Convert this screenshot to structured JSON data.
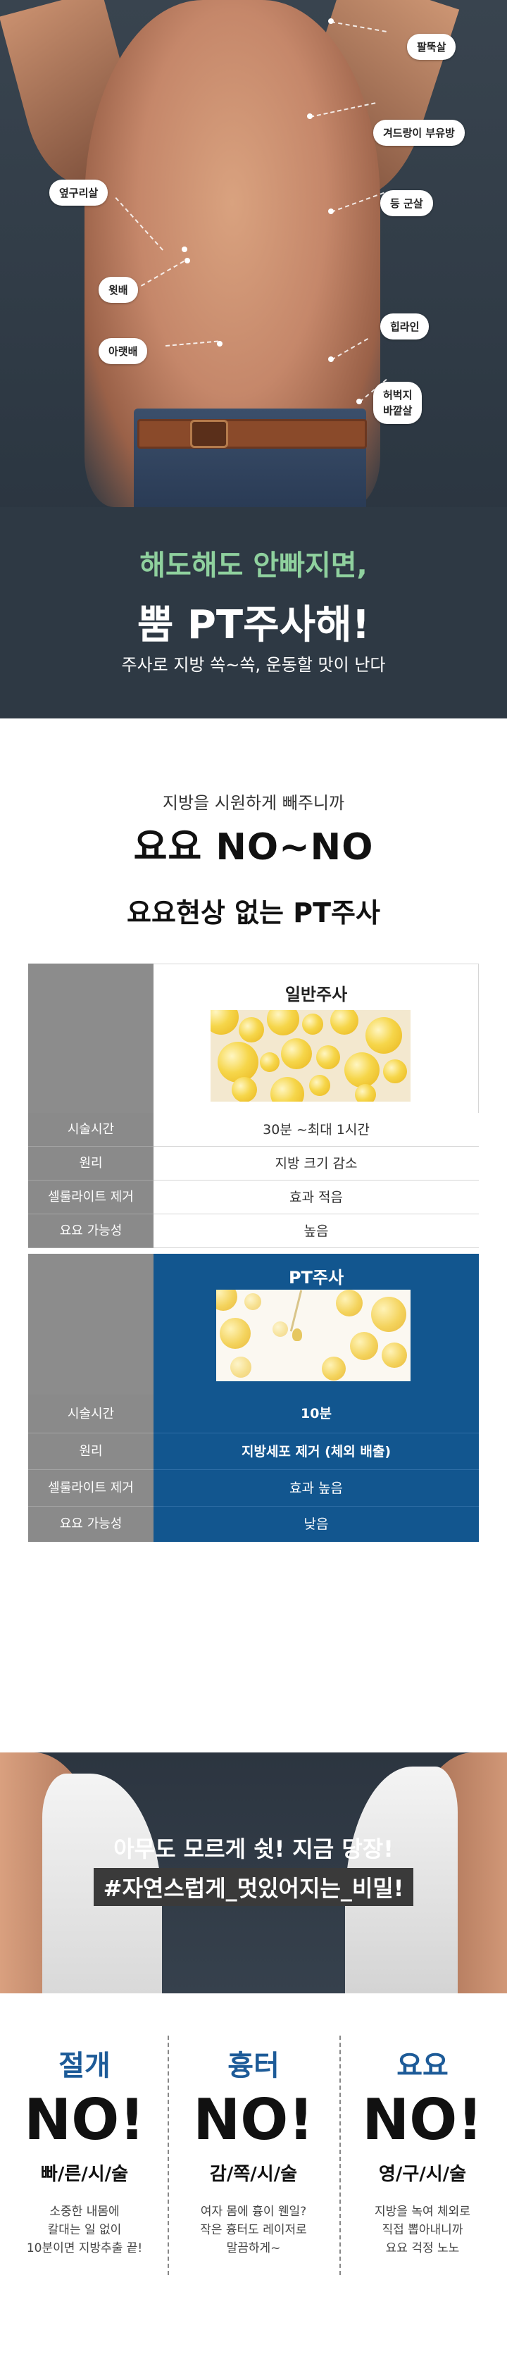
{
  "hero": {
    "labels": {
      "arm": "팔뚝살",
      "armpit": "겨드랑이 부유방",
      "side": "옆구리살",
      "back": "등 군살",
      "belly": "윗배",
      "hip": "힙라인",
      "lowerbelly": "아랫배",
      "thigh1": "허벅지",
      "thigh2": "바깥살"
    },
    "line1": "해도해도 안빠지면,",
    "line2": "뿜 PT주사해!",
    "line3": "주사로 지방 쏙~쏙, 운동할 맛이 난다"
  },
  "intro": {
    "subtitle": "지방을 시원하게 빼주니까",
    "title": "요요 NO~NO",
    "heading": "요요현상 없는 PT주사"
  },
  "comparison": {
    "general": {
      "caption": "일반주사",
      "rows": [
        {
          "label": "시술시간",
          "value": "30분 ~최대 1시간"
        },
        {
          "label": "원리",
          "value": "지방 크기 감소"
        },
        {
          "label": "셀룰라이트 제거",
          "value": "효과 적음"
        },
        {
          "label": "요요 가능성",
          "value": "높음"
        }
      ]
    },
    "pt": {
      "caption": "PT주사",
      "rows": [
        {
          "label": "시술시간",
          "value": "10분"
        },
        {
          "label": "원리",
          "value": "지방세포 제거 (체외 배출)"
        },
        {
          "label": "셀룰라이트 제거",
          "value": "효과 높음"
        },
        {
          "label": "요요 가능성",
          "value": "낮음"
        }
      ]
    }
  },
  "secret": {
    "line1": "아무도 모르게 쉿! 지금 당장!",
    "line2": "#자연스럽게_멋있어지는_비밀!"
  },
  "columns": [
    {
      "top": "절개",
      "no": "NO!",
      "sub": "빠/른/시/술",
      "desc1": "소중한 내몸에",
      "desc2": "칼대는 일 없이",
      "desc3": "10분이면 지방추출 끝!"
    },
    {
      "top": "흉터",
      "no": "NO!",
      "sub": "감/쪽/시/술",
      "desc1": "여자 몸에 흉이 웬일?",
      "desc2": "작은 흉터도 레이저로",
      "desc3": "말끔하게~"
    },
    {
      "top": "요요",
      "no": "NO!",
      "sub": "영/구/시/술",
      "desc1": "지방을 녹여 체외로",
      "desc2": "직접 뽑아내니까",
      "desc3": "요요 걱정 노노"
    }
  ],
  "colors": {
    "accent_blue": "#12568f",
    "green": "#8fd19e",
    "dark": "#2e3944",
    "gray_label": "#8a8a8a"
  }
}
